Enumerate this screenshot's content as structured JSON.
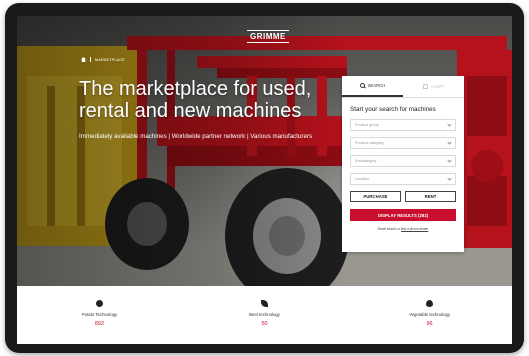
{
  "brand": {
    "logo_text": "GRIMME"
  },
  "breadcrumb": {
    "current": "MARKETPLACE"
  },
  "hero": {
    "title": "The marketplace for used, rental and new machines",
    "subtitle": "Immediately available machines | Worldwide partner network | Various manufacturers"
  },
  "search_panel": {
    "tabs": [
      {
        "label": "SEARCH",
        "icon": "search-icon",
        "active": true
      },
      {
        "label": "ALERT",
        "icon": "bell-icon",
        "active": false
      }
    ],
    "heading": "Start your search for machines",
    "fields": [
      {
        "placeholder": "Product group"
      },
      {
        "placeholder": "Product category"
      },
      {
        "placeholder": "Subcategory"
      },
      {
        "placeholder": "Location"
      }
    ],
    "purchase_label": "PURCHASE",
    "rent_label": "RENT",
    "cta_label": "DISPLAY RESULTS (282)",
    "reset_prefix": "Reset search or",
    "reset_link": "find a phone dealer"
  },
  "stats": [
    {
      "label": "Potato Technology",
      "count": "892",
      "icon": "potato-icon"
    },
    {
      "label": "Beet technology",
      "count": "50",
      "icon": "beet-icon"
    },
    {
      "label": "Vegetable technology",
      "count": "96",
      "icon": "vegetable-icon"
    }
  ],
  "colors": {
    "accent": "#c8102e",
    "machine_red": "#b5121b",
    "frame": "#1a1a1a"
  }
}
